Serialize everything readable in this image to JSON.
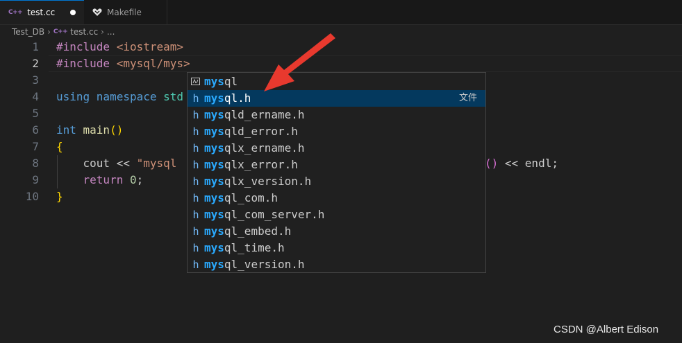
{
  "tabs": [
    {
      "label": "test.cc",
      "icon": "cpp-icon",
      "glyph": "C++",
      "active": true,
      "dirty": true
    },
    {
      "label": "Makefile",
      "icon": "makefile-icon",
      "active": false
    }
  ],
  "breadcrumb": {
    "folder": "Test_DB",
    "file_glyph": "C++",
    "file": "test.cc",
    "rest": "..."
  },
  "editor": {
    "current_line": 2,
    "lines": [
      {
        "n": "1",
        "tokens": [
          [
            "kw-dir",
            "#include "
          ],
          [
            "str",
            "<iostream>"
          ]
        ]
      },
      {
        "n": "2",
        "tokens": [
          [
            "kw-dir",
            "#include "
          ],
          [
            "str",
            "<mysql/mys>"
          ]
        ]
      },
      {
        "n": "3",
        "tokens": []
      },
      {
        "n": "4",
        "tokens": [
          [
            "kw",
            "using "
          ],
          [
            "kw",
            "namespace "
          ],
          [
            "type",
            "std"
          ]
        ]
      },
      {
        "n": "5",
        "tokens": []
      },
      {
        "n": "6",
        "tokens": [
          [
            "kw",
            "int "
          ],
          [
            "fn",
            "main"
          ],
          [
            "brace",
            "()"
          ]
        ]
      },
      {
        "n": "7",
        "tokens": [
          [
            "brace",
            "{"
          ]
        ]
      },
      {
        "n": "8",
        "tokens": [
          [
            "plain",
            "    cout "
          ],
          [
            "plain",
            "<< "
          ],
          [
            "str",
            "\"mysql"
          ]
        ],
        "tail": [
          [
            "paren",
            "()"
          ],
          [
            "plain",
            " << endl;"
          ]
        ]
      },
      {
        "n": "9",
        "tokens": [
          [
            "plain",
            "    "
          ],
          [
            "kw-dir",
            "return "
          ],
          [
            "num",
            "0"
          ],
          [
            "plain",
            ";"
          ]
        ]
      },
      {
        "n": "10",
        "tokens": [
          [
            "brace",
            "}"
          ]
        ]
      }
    ]
  },
  "suggest": {
    "items": [
      {
        "icon": "module-icon",
        "match": "mys",
        "rest": "ql",
        "detail": ""
      },
      {
        "icon": "h",
        "match": "mys",
        "rest": "ql.h",
        "detail": "文件",
        "selected": true
      },
      {
        "icon": "h",
        "match": "mys",
        "rest": "qld_ername.h",
        "detail": ""
      },
      {
        "icon": "h",
        "match": "mys",
        "rest": "qld_error.h",
        "detail": ""
      },
      {
        "icon": "h",
        "match": "mys",
        "rest": "qlx_ername.h",
        "detail": ""
      },
      {
        "icon": "h",
        "match": "mys",
        "rest": "qlx_error.h",
        "detail": ""
      },
      {
        "icon": "h",
        "match": "mys",
        "rest": "qlx_version.h",
        "detail": ""
      },
      {
        "icon": "h",
        "match": "mys",
        "rest": "ql_com.h",
        "detail": ""
      },
      {
        "icon": "h",
        "match": "mys",
        "rest": "ql_com_server.h",
        "detail": ""
      },
      {
        "icon": "h",
        "match": "mys",
        "rest": "ql_embed.h",
        "detail": ""
      },
      {
        "icon": "h",
        "match": "mys",
        "rest": "ql_time.h",
        "detail": ""
      },
      {
        "icon": "h",
        "match": "mys",
        "rest": "ql_version.h",
        "detail": ""
      }
    ]
  },
  "annotation": {
    "color": "#e8392e"
  },
  "watermark": "CSDN @Albert Edison"
}
